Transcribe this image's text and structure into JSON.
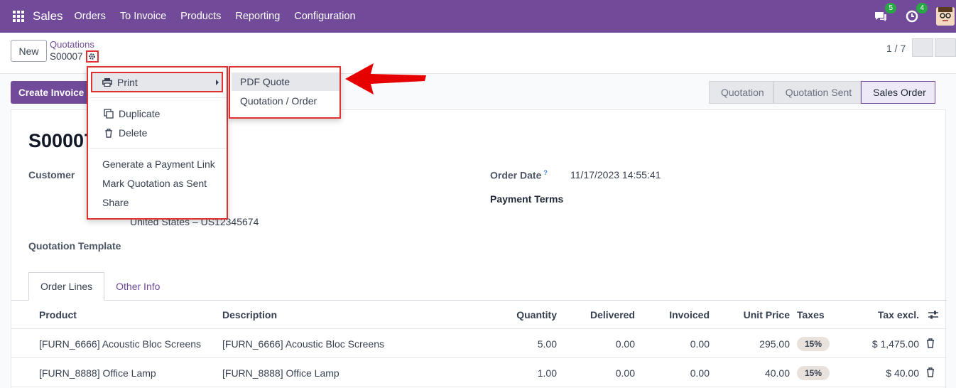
{
  "navbar": {
    "app_name": "Sales",
    "menu": [
      "Orders",
      "To Invoice",
      "Products",
      "Reporting",
      "Configuration"
    ],
    "messages_count": "5",
    "activities_count": "4",
    "bg_color": "#714b9a"
  },
  "control": {
    "new_label": "New",
    "breadcrumb": "Quotations",
    "record_name": "S00007",
    "pager": "1 / 7"
  },
  "actions": {
    "create_invoice": "Create Invoice"
  },
  "statusbar": [
    "Quotation",
    "Quotation Sent",
    "Sales Order"
  ],
  "form": {
    "title": "S00007",
    "customer_label": "Customer",
    "customer_address_line": "United States – US12345674",
    "template_label": "Quotation Template",
    "order_date_label": "Order Date",
    "order_date_help": "?",
    "order_date_value": "11/17/2023 14:55:41",
    "payment_terms_label": "Payment Terms"
  },
  "tabs": [
    "Order Lines",
    "Other Info"
  ],
  "table": {
    "headers": [
      "Product",
      "Description",
      "Quantity",
      "Delivered",
      "Invoiced",
      "Unit Price",
      "Taxes",
      "Tax excl."
    ],
    "rows": [
      {
        "product": "[FURN_6666] Acoustic Bloc Screens",
        "description": "[FURN_6666] Acoustic Bloc Screens",
        "quantity": "5.00",
        "delivered": "0.00",
        "invoiced": "0.00",
        "unit_price": "295.00",
        "taxes": "15%",
        "subtotal": "$ 1,475.00"
      },
      {
        "product": "[FURN_8888] Office Lamp",
        "description": "[FURN_8888] Office Lamp",
        "quantity": "1.00",
        "delivered": "0.00",
        "invoiced": "0.00",
        "unit_price": "40.00",
        "taxes": "15%",
        "subtotal": "$ 40.00"
      }
    ]
  },
  "dropdown": {
    "print": "Print",
    "duplicate": "Duplicate",
    "delete": "Delete",
    "payment_link": "Generate a Payment Link",
    "mark_sent": "Mark Quotation as Sent",
    "share": "Share"
  },
  "submenu": {
    "pdf_quote": "PDF Quote",
    "quotation_order": "Quotation / Order"
  },
  "highlight_color": "#e03131"
}
